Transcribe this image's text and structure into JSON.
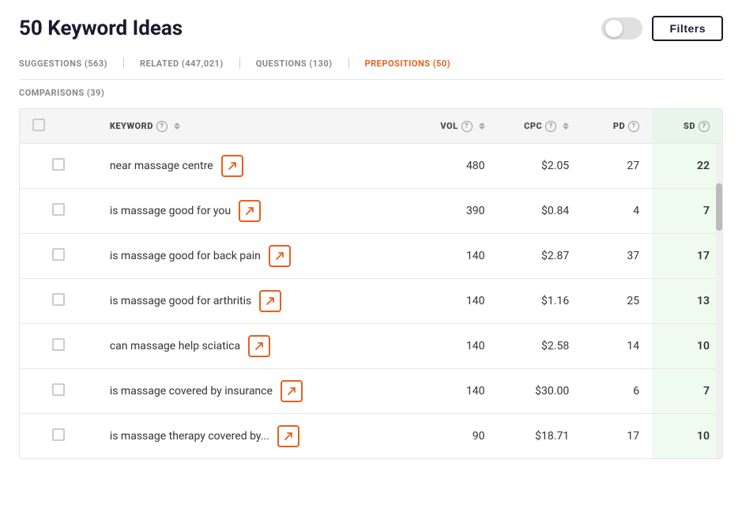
{
  "header": {
    "title": "50 Keyword Ideas",
    "filters_label": "Filters"
  },
  "tabs": [
    {
      "id": "suggestions",
      "label": "SUGGESTIONS (563)",
      "active": false
    },
    {
      "id": "related",
      "label": "RELATED (447,021)",
      "active": false
    },
    {
      "id": "questions",
      "label": "QUESTIONS (130)",
      "active": false
    },
    {
      "id": "prepositions",
      "label": "PREPOSITIONS (50)",
      "active": true
    },
    {
      "id": "comparisons",
      "label": "COMPARISONS (39)",
      "active": false
    }
  ],
  "table": {
    "columns": [
      {
        "id": "keyword",
        "label": "KEYWORD",
        "has_help": true,
        "has_sort": true
      },
      {
        "id": "vol",
        "label": "VOL",
        "has_help": true,
        "has_sort": true
      },
      {
        "id": "cpc",
        "label": "CPC",
        "has_help": true,
        "has_sort": true
      },
      {
        "id": "pd",
        "label": "PD",
        "has_help": true,
        "has_sort": false
      },
      {
        "id": "sd",
        "label": "SD",
        "has_help": true,
        "has_sort": false
      }
    ],
    "rows": [
      {
        "keyword": "near massage centre",
        "vol": "480",
        "cpc": "$2.05",
        "pd": "27",
        "sd": "22"
      },
      {
        "keyword": "is massage good for you",
        "vol": "390",
        "cpc": "$0.84",
        "pd": "4",
        "sd": "7"
      },
      {
        "keyword": "is massage good for back pain",
        "vol": "140",
        "cpc": "$2.87",
        "pd": "37",
        "sd": "17"
      },
      {
        "keyword": "is massage good for arthritis",
        "vol": "140",
        "cpc": "$1.16",
        "pd": "25",
        "sd": "13"
      },
      {
        "keyword": "can massage help sciatica",
        "vol": "140",
        "cpc": "$2.58",
        "pd": "14",
        "sd": "10"
      },
      {
        "keyword": "is massage covered by insurance",
        "vol": "140",
        "cpc": "$30.00",
        "pd": "6",
        "sd": "7"
      },
      {
        "keyword": "is massage therapy covered by...",
        "vol": "90",
        "cpc": "$18.71",
        "pd": "17",
        "sd": "10"
      }
    ]
  },
  "icons": {
    "redirect": "↗",
    "help": "?",
    "sort_up": "▲",
    "sort_down": "▼"
  }
}
